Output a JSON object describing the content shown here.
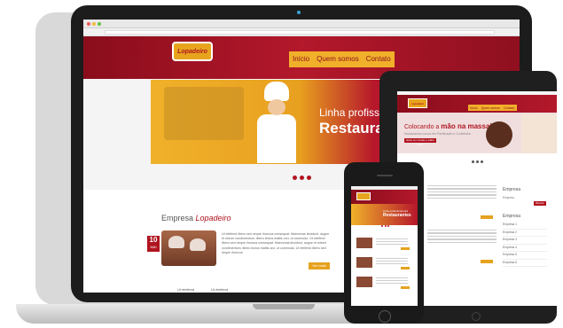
{
  "site": {
    "logo": "Lopadeiro",
    "nav": [
      "Início",
      "Quem somos",
      "Contato"
    ]
  },
  "hero": {
    "line1": "Linha profissio",
    "line2": "Restaura"
  },
  "section": {
    "title_prefix": "Empresa ",
    "title_brand": "Lopadeiro",
    "date_day": "10",
    "date_month": "MAI",
    "paragraph": "Ut eleifend libero sed neque rhoncus consequat. Maecenas tincidunt, augue et rutrum condimentum, libero lectus mattis orci, ut commodo. Ut eleifend libero sed neque rhoncus consequat. Maecenas tincidunt, augue et rutrum condimentum, libero lectus mattis orci, ut commodo. Ut eleifend libero sed neque rhoncus",
    "more_button": "Ver mais",
    "link1": "Ut eleifend",
    "link2": "Ut eleifend"
  },
  "tablet": {
    "logo": "Lopadeiro",
    "nav": [
      "Início",
      "Quem somos",
      "Contato"
    ],
    "hero_text_prefix": "Colocando a ",
    "hero_text_bold": "mão na massa!",
    "hero_sub": "Marcacamos cursos em Panificação e Confeitaria",
    "hero_button": "Entre em contato e saiba mais!",
    "sidebar_title": "Empresa",
    "sidebar_input": "Empresa",
    "sidebar_button": "Buscar",
    "sidebar_title2": "Empresa",
    "sidebar_items": [
      "Empresa 1",
      "Empresa 2",
      "Empresa 3",
      "Empresa 4",
      "Empresa 5",
      "Empresa 6"
    ]
  },
  "phone": {
    "hero_line1": "Linha profissional para",
    "hero_line2": "Restaurantes"
  }
}
